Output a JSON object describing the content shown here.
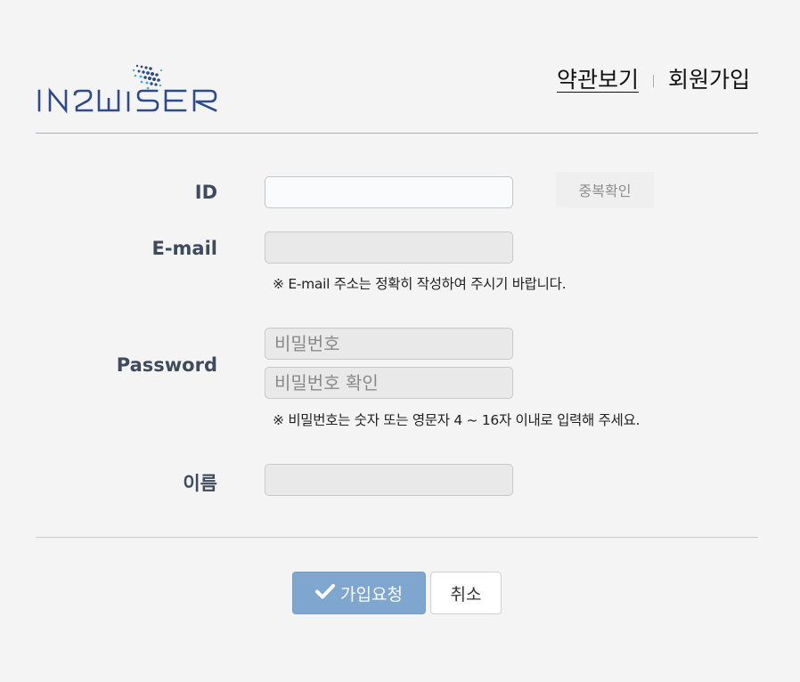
{
  "logo": {
    "text": "IN2WISER",
    "colors": {
      "text": "#2e4a8c",
      "dots_dark": "#2e4a8c",
      "dots_light": "#3ab0e0"
    }
  },
  "header": {
    "terms_link": "약관보기",
    "signup_link": "회원가입"
  },
  "form": {
    "id_label": "ID",
    "id_value": "",
    "duplicate_check_button": "중복확인",
    "email_label": "E-mail",
    "email_value": "",
    "email_hint": "※ E-mail 주소는 정확히 작성하여 주시기 바랍니다.",
    "password_label": "Password",
    "password_placeholder": "비밀번호",
    "password_confirm_placeholder": "비밀번호 확인",
    "password_hint": "※ 비밀번호는 숫자 또는 영문자 4 ~ 16자 이내로 입력해 주세요.",
    "name_label": "이름",
    "name_value": ""
  },
  "actions": {
    "submit_label": "가입요청",
    "submit_icon": "checkmark-icon",
    "cancel_label": "취소"
  },
  "colors": {
    "background": "#f4f4f4",
    "label": "#3d4b5c",
    "submit_bg": "#7ea6cf"
  }
}
